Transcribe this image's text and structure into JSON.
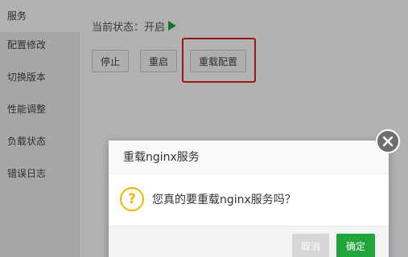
{
  "sidebar": {
    "items": [
      {
        "label": "服务",
        "active": true
      },
      {
        "label": "配置修改",
        "active": false
      },
      {
        "label": "切换版本",
        "active": false
      },
      {
        "label": "性能调整",
        "active": false
      },
      {
        "label": "负载状态",
        "active": false
      },
      {
        "label": "错误日志",
        "active": false
      }
    ]
  },
  "main": {
    "status_label": "当前状态：开启",
    "status_icon": "play-icon",
    "status_color": "#20a53a",
    "buttons": {
      "stop": "停止",
      "restart": "重启",
      "reload": "重载配置"
    },
    "highlight_color": "#e02020"
  },
  "dialog": {
    "title": "重载nginx服务",
    "icon": "question-icon",
    "question_mark": "?",
    "message": "您真的要重载nginx服务吗？",
    "cancel_label": "取消",
    "confirm_label": "确定",
    "confirm_color": "#20a53a",
    "close_icon": "close-icon"
  }
}
